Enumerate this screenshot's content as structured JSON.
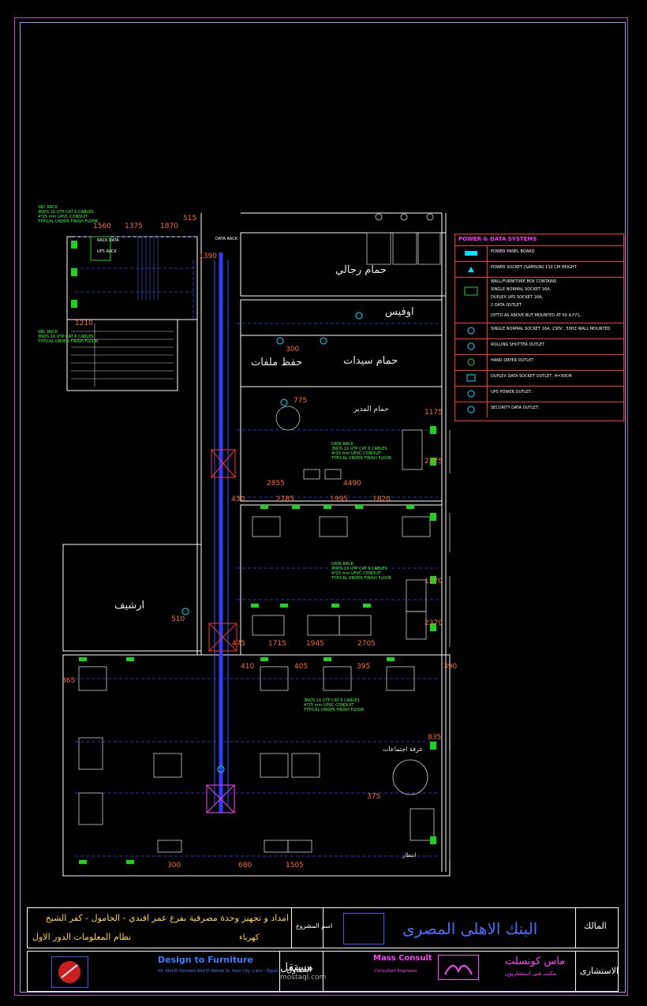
{
  "rooms": {
    "men_wc": "حمام رجالي",
    "office": "اوفيس",
    "files": "حفظ ملفات",
    "women_wc": "حمام سيدات",
    "manager": "حمام المدير",
    "archive": "ارشيف",
    "meeting": "غرفة اجتماعات",
    "waiting": "انتظار"
  },
  "notes": {
    "rack_a": "RACK\nDATA",
    "rack_b": "UPS\nRACK",
    "rack_c": "DATA\nRACK",
    "cable_note_1": "SBC RACK\n3NOS 1X UTP CAT 6 CABLES\n4*25 mm UPVC CONDUIT\nTYPICAL UNDER FINISH FLOOR",
    "cable_note_2": "SBC RACK\n3NOS 1X UTP CAT 6 CABLES\nTYPICAL UNDER FINISH FLOOR",
    "cable_note_3": "DATA RACK\n3NOS 1X UTP CAT 6 CABLES\n4*25 mm UPVC CONDUIT\nTYPICAL UNDER FINISH FLOOR",
    "cable_note_4": "DATA RACK\n3NOS 1X UTP CAT 6 CABLES\n4*25 mm UPVC CONDUIT\nTYPICAL UNDER FINISH FLOOR",
    "cable_note_5": "3NOS 1X UTP CAT 6 CABLES\n4*25 mm UPVC CONDUIT\nTYPICAL UNDER FINISH FLOOR"
  },
  "dimensions": [
    "1560",
    "1375",
    "1870",
    "515",
    "1390",
    "1210",
    "300",
    "775",
    "2855",
    "4490",
    "2785",
    "1995",
    "1820",
    "430",
    "510",
    "475",
    "1715",
    "1945",
    "2705",
    "365",
    "410",
    "405",
    "395",
    "390",
    "300",
    "680",
    "1505",
    "375",
    "835",
    "1175",
    "2375",
    "1570",
    "2370"
  ],
  "legend": {
    "title": "POWER & DATA SYSTEMS",
    "rows": [
      "POWER PANEL BOARD",
      "POWER SOCKET (SAMSON) 110 CM HEIGHT",
      "WALL/FURNITURE BOX CONTAINS",
      "SINGLE NORMAL SOCKET 16A,",
      "DUPLEX UPS SOCKET 16A,",
      "2 DATA OUTLET",
      "DITTO AS ABOVE BUT MOUNTED AT 50 A.F.F.L.",
      "SINGLE NORMAL SOCKET 16A, 230V , 50HZ WALL MOUNTED",
      "ROLLING SHUTTER OUTLET",
      "HAND DRYER OUTLET",
      "DUPLEX DATA SOCKET OUTLET, H=30CM",
      "UPS POWER OUTLET.",
      "SECURITY DATA OUTLET."
    ]
  },
  "title_block": {
    "project": "امداد و تجهيز وحدة مصرفية بفرع عمر افندي - الحامول - كفر الشيخ",
    "drawing": "نظام المعلومات الدور الاول",
    "discipline": "كهرباء",
    "project_label": "اسم المشروع",
    "bank": "البنك الاهلى المصرى",
    "owner_label": "المالك",
    "contractor_label": "المقاول",
    "consultant_label": "الاستشارى",
    "contractor_name": "Design to Furniture",
    "contractor_address": "59, Abd El Hameed Abd El Wahab St, Nasr City, Cairo - Egypt",
    "consultant_name": "Mass Consult",
    "consultant_sub": "Consultant Engineers",
    "consultant_ar": "ماس كونسلت",
    "consultant_ar_sub": "مكتب فنى استشاريون",
    "watermark": "مستقل",
    "watermark_url": "mostaql.com"
  }
}
